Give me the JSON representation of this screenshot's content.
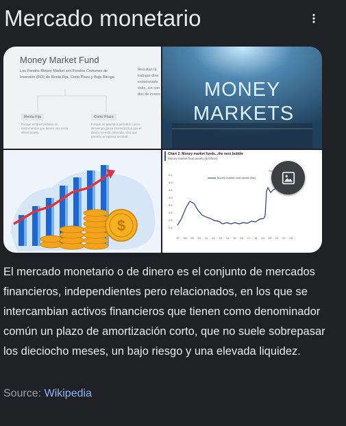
{
  "panel": {
    "title": "Mercado monetario",
    "more_icon": "more-vert-icon",
    "description": "El mercado monetario o de dinero es el conjunto de mercados financieros, independientes pero relacionados, en los que se intercambian activos financieros que tienen como denominador común un plazo de amortización corto, que no suele sobrepasar los dieciocho meses, un bajo riesgo y una elevada liquidez.",
    "source_label": "Source:",
    "source_link": "Wikipedia"
  },
  "images": {
    "img1": {
      "title": "Money Market Fund",
      "text": "Los Fondos Money Market son Fondos Comunes de Inversión (FCI) de Renta Fija, Corto Plazo y Bajo Riesgo.",
      "side_text": "Resultan la trabajar dine estacionado éxito, sin con dos de invers",
      "node1": "Renta Fija",
      "node1_text": "Porque están invertidos en instrumentos que tienen una renta determinada.",
      "node2": "Corto Plazo",
      "node2_text": "Porque se apunta a períodos cortos de tiempo (poca inversión) los que el dinero no está colocado, sino que genera un ingreso residual."
    },
    "img2": {
      "line1": "MONEY",
      "line2": "MARKETS"
    },
    "img4": {
      "title": "Chart 2: Money market funds...the next bubble",
      "subtitle": "Money market fund assets ($ trillion)",
      "legend": "Money market fund assets ($tn)",
      "record": "Record $5.5tn",
      "y_ticks": [
        "5.5",
        "5.0",
        "4.5",
        "4.0",
        "3.5",
        "3.0",
        "2.5",
        "2.0"
      ],
      "x_ticks": [
        "'07",
        "'08",
        "'09",
        "'10",
        "'11",
        "'12",
        "'13",
        "'14",
        "'15",
        "'16",
        "'17",
        "'18",
        "'19",
        "'20",
        "'21",
        "'22",
        "'23"
      ]
    },
    "image_button_icon": "image-icon"
  }
}
